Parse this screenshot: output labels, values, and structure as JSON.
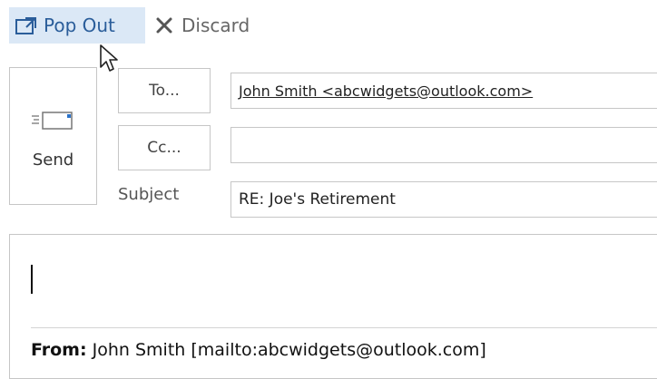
{
  "toolbar": {
    "popout_label": "Pop Out",
    "popout_icon": "pop-out-window-icon",
    "discard_label": "Discard",
    "discard_icon": "close-x-icon"
  },
  "compose": {
    "send_label": "Send",
    "send_icon": "envelope-send-icon",
    "to_button": "To...",
    "cc_button": "Cc...",
    "subject_label": "Subject",
    "to_value": "John Smith <abcwidgets@outlook.com>",
    "cc_value": "",
    "subject_value": "RE: Joe's Retirement"
  },
  "body": {
    "from_label": "From:",
    "from_value": "John Smith [mailto:abcwidgets@outlook.com]"
  },
  "colors": {
    "popout_highlight": "#dbe8f6",
    "popout_text": "#2a5d9a",
    "border": "#c6c6c6"
  }
}
